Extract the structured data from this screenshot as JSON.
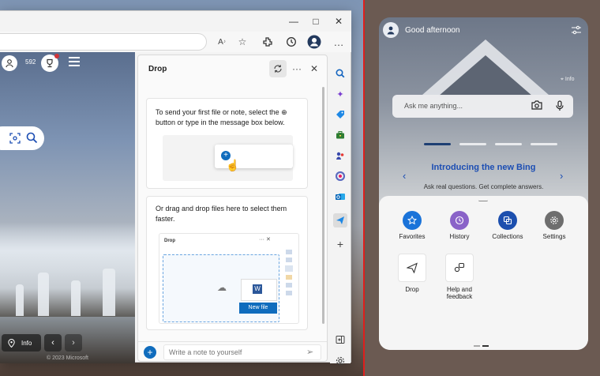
{
  "browser": {
    "window_controls": {
      "minimize": "—",
      "maximize": "□",
      "close": "✕"
    },
    "toolbar_icons": [
      "read-aloud-icon",
      "favorite-star-icon",
      "extensions-icon",
      "history-icon",
      "profile-icon",
      "more-icon"
    ]
  },
  "bing_page": {
    "points": "592",
    "info_label": "Info",
    "copyright": "© 2023 Microsoft"
  },
  "drop": {
    "title": "Drop",
    "card1_text": "To send your first file or note, select the ⊕ button or type in the message box below.",
    "card2_text": "Or drag and drop files here to select them faster.",
    "mini_title": "Drop",
    "new_file_label": "New file",
    "note_placeholder": "Write a note to yourself"
  },
  "sidebar_icons": [
    "search-icon",
    "copilot-icon",
    "shopping-icon",
    "tools-icon",
    "games-icon",
    "office-icon",
    "outlook-icon",
    "drop-icon",
    "add-icon",
    "hide-sidebar-icon",
    "settings-icon"
  ],
  "tablet": {
    "greeting": "Good afternoon",
    "info_tag": "Info",
    "search_placeholder": "Ask me anything...",
    "promo_title": "Introducing the new Bing",
    "promo_subtitle": "Ask real questions. Get complete answers.",
    "apps": [
      {
        "label": "Favorites",
        "icon": "star-icon",
        "color": "#1a73d9"
      },
      {
        "label": "History",
        "icon": "history-icon",
        "color": "#8a63c8"
      },
      {
        "label": "Collections",
        "icon": "collections-icon",
        "color": "#1c4fae"
      },
      {
        "label": "Settings",
        "icon": "gear-icon",
        "color": "#6e6e6e"
      }
    ],
    "tiles": [
      {
        "label": "Drop",
        "icon": "send-icon"
      },
      {
        "label": "Help and feedback",
        "icon": "help-feedback-icon"
      }
    ]
  },
  "colors": {
    "accent": "#0f6cbd",
    "divider": "#e0201e",
    "bing_title": "#1b4db3"
  }
}
